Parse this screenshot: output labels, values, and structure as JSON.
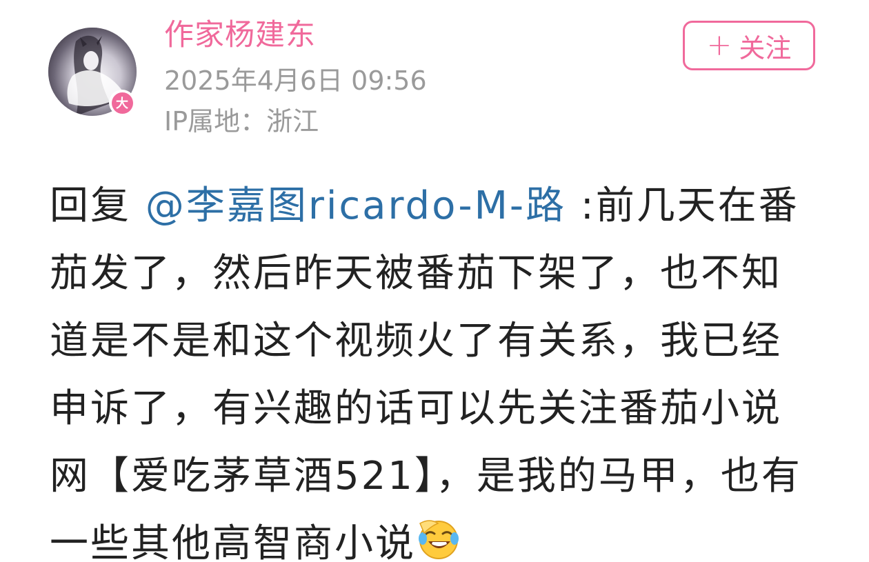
{
  "post": {
    "author": {
      "name": "作家杨建东",
      "verify_badge": "大",
      "avatar_icon": "avatar-image"
    },
    "timestamp": "2025年4月6日 09:56",
    "ip_location": "IP属地：浙江",
    "follow_button": {
      "icon": "plus-icon",
      "label": "关注"
    },
    "content": {
      "reply_prefix": "回复 ",
      "mention": "@李嘉图ricardo-M-路",
      "text": " :前几天在番茄发了，然后昨天被番茄下架了，也不知道是不是和这个视频火了有关系，我已经申诉了，有兴趣的话可以先关注番茄小说网【爱吃茅草酒521】，是我的马甲，也有一些其他高智商小说",
      "emoji": "laughing-crying-emoji"
    }
  },
  "colors": {
    "accent": "#f0699b",
    "mention": "#2d6fa6",
    "meta_text": "#9a9a9a",
    "body_text": "#222222"
  }
}
